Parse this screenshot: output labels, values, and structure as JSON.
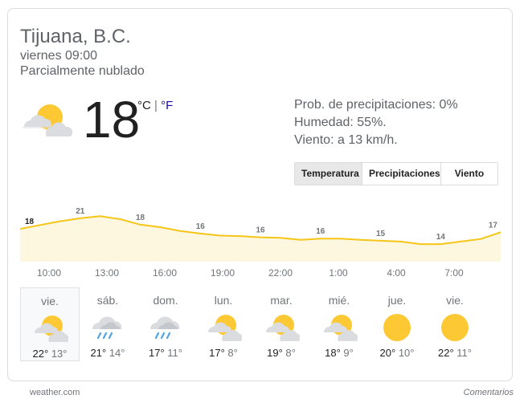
{
  "location": "Tijuana, B.C.",
  "datetime": "viernes 09:00",
  "condition": "Parcialmente nublado",
  "current": {
    "icon": "partly-cloudy-icon",
    "temperature": "18",
    "unit_c": "°C",
    "unit_separator": " | ",
    "unit_f": "°F"
  },
  "stats": {
    "precipitation": "Prob. de precipitaciones: 0%",
    "humidity": "Humedad: 55%.",
    "wind": "Viento: a 13 km/h."
  },
  "tabs": [
    {
      "label": "Temperatura",
      "active": true
    },
    {
      "label": "Precipitaciones",
      "active": false
    },
    {
      "label": "Viento",
      "active": false
    }
  ],
  "colors": {
    "line": "#f5c518",
    "fill": "#fef7e0",
    "sun": "#fcc934",
    "cloud": "#dadce0",
    "rain": "#4fa3e0"
  },
  "chart_data": {
    "type": "area",
    "x": [
      "09:00",
      "10:00",
      "11:00",
      "12:00",
      "13:00",
      "14:00",
      "15:00",
      "16:00",
      "17:00",
      "18:00",
      "19:00",
      "20:00",
      "21:00",
      "22:00",
      "23:00",
      "00:00",
      "01:00",
      "02:00",
      "03:00",
      "04:00",
      "05:00",
      "06:00",
      "07:00",
      "08:00"
    ],
    "values": [
      18,
      18.9,
      19.8,
      20.5,
      21,
      20.3,
      19,
      18.4,
      17.5,
      16.9,
      16.4,
      16.3,
      16,
      15.9,
      15.4,
      15.7,
      15.7,
      15.4,
      15.2,
      15,
      14.4,
      14.4,
      15,
      15.6,
      17.2
    ],
    "labels": [
      {
        "index": 0,
        "text": "18"
      },
      {
        "index": 3,
        "text": "21"
      },
      {
        "index": 6,
        "text": "18"
      },
      {
        "index": 9,
        "text": "16"
      },
      {
        "index": 12,
        "text": "16"
      },
      {
        "index": 15,
        "text": "16"
      },
      {
        "index": 18,
        "text": "15"
      },
      {
        "index": 21,
        "text": "14"
      },
      {
        "index": 24,
        "text": "17"
      }
    ],
    "tick_labels": [
      "10:00",
      "13:00",
      "16:00",
      "19:00",
      "22:00",
      "1:00",
      "4:00",
      "7:00"
    ]
  },
  "forecast": [
    {
      "day": "vie.",
      "icon": "partly-cloudy-icon",
      "hi": "22°",
      "lo": "13°",
      "selected": true
    },
    {
      "day": "sáb.",
      "icon": "rain-icon",
      "hi": "21°",
      "lo": "14°",
      "selected": false
    },
    {
      "day": "dom.",
      "icon": "rain-icon",
      "hi": "17°",
      "lo": "11°",
      "selected": false
    },
    {
      "day": "lun.",
      "icon": "partly-cloudy-icon",
      "hi": "17°",
      "lo": "8°",
      "selected": false
    },
    {
      "day": "mar.",
      "icon": "partly-cloudy-icon",
      "hi": "19°",
      "lo": "8°",
      "selected": false
    },
    {
      "day": "mié.",
      "icon": "partly-cloudy-icon",
      "hi": "18°",
      "lo": "9°",
      "selected": false
    },
    {
      "day": "jue.",
      "icon": "sunny-icon",
      "hi": "20°",
      "lo": "10°",
      "selected": false
    },
    {
      "day": "vie.",
      "icon": "sunny-icon",
      "hi": "22°",
      "lo": "11°",
      "selected": false
    }
  ],
  "footer": {
    "source": "weather.com",
    "feedback": "Comentarios"
  }
}
